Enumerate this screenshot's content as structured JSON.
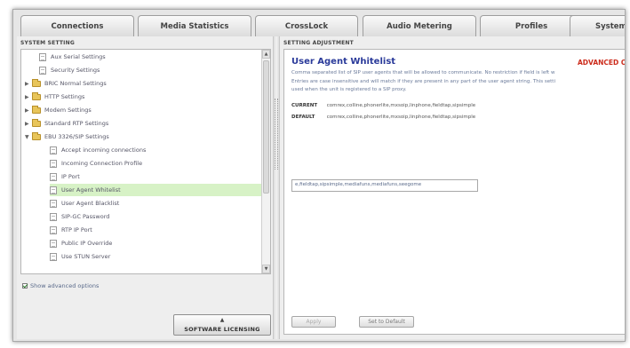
{
  "tabs": [
    {
      "label": "Connections"
    },
    {
      "label": "Media Statistics"
    },
    {
      "label": "CrossLock"
    },
    {
      "label": "Audio Metering"
    },
    {
      "label": "Profiles"
    },
    {
      "label": "System S"
    }
  ],
  "left_panel": {
    "title": "SYSTEM SETTING",
    "tree": [
      {
        "label": "Aux Serial Settings",
        "type": "doc",
        "level": 1
      },
      {
        "label": "Security Settings",
        "type": "doc",
        "level": 1
      },
      {
        "label": "BRIC Normal Settings",
        "type": "folder",
        "level": 0
      },
      {
        "label": "HTTP Settings",
        "type": "folder",
        "level": 0
      },
      {
        "label": "Modem Settings",
        "type": "folder",
        "level": 0
      },
      {
        "label": "Standard RTP Settings",
        "type": "folder",
        "level": 0
      },
      {
        "label": "EBU 3326/SIP Settings",
        "type": "folder",
        "level": 0,
        "expanded": true
      },
      {
        "label": "Accept incoming connections",
        "type": "doc",
        "level": 2
      },
      {
        "label": "Incoming Connection Profile",
        "type": "doc",
        "level": 2
      },
      {
        "label": "IP Port",
        "type": "doc",
        "level": 2
      },
      {
        "label": "User Agent Whitelist",
        "type": "doc",
        "level": 2,
        "selected": true
      },
      {
        "label": "User Agent Blacklist",
        "type": "doc",
        "level": 2
      },
      {
        "label": "SIP-GC Password",
        "type": "doc",
        "level": 2
      },
      {
        "label": "RTP IP Port",
        "type": "doc",
        "level": 2
      },
      {
        "label": "Public IP Override",
        "type": "doc",
        "level": 2
      },
      {
        "label": "Use STUN Server",
        "type": "doc",
        "level": 2
      }
    ],
    "show_advanced": "Show advanced options",
    "software_button": "SOFTWARE LICENSING"
  },
  "right_panel": {
    "title": "SETTING ADJUSTMENT",
    "setting_title": "User Agent Whitelist",
    "advanced_label": "ADVANCED O",
    "description": [
      "Comma separated list of SIP user agents that will be allowed to communicate. No restriction if field is left w",
      "Entries are case insensitive and will match if they are present in any part of the user agent string. This setti",
      "used when the unit is registered to a SIP proxy."
    ],
    "current_label": "CURRENT",
    "current_value": "comrex,colline,phonerlite,mxsoip,linphone,fieldtap,sipsimple",
    "default_label": "DEFAULT",
    "default_value": "comrex,colline,phonerlite,mxsoip,linphone,fieldtap,sipsimple",
    "input_value": "e,fieldtap,sipsimple,mediafuns,mediafuns,seegome",
    "apply_button": "Apply",
    "default_button": "Set to Default"
  }
}
